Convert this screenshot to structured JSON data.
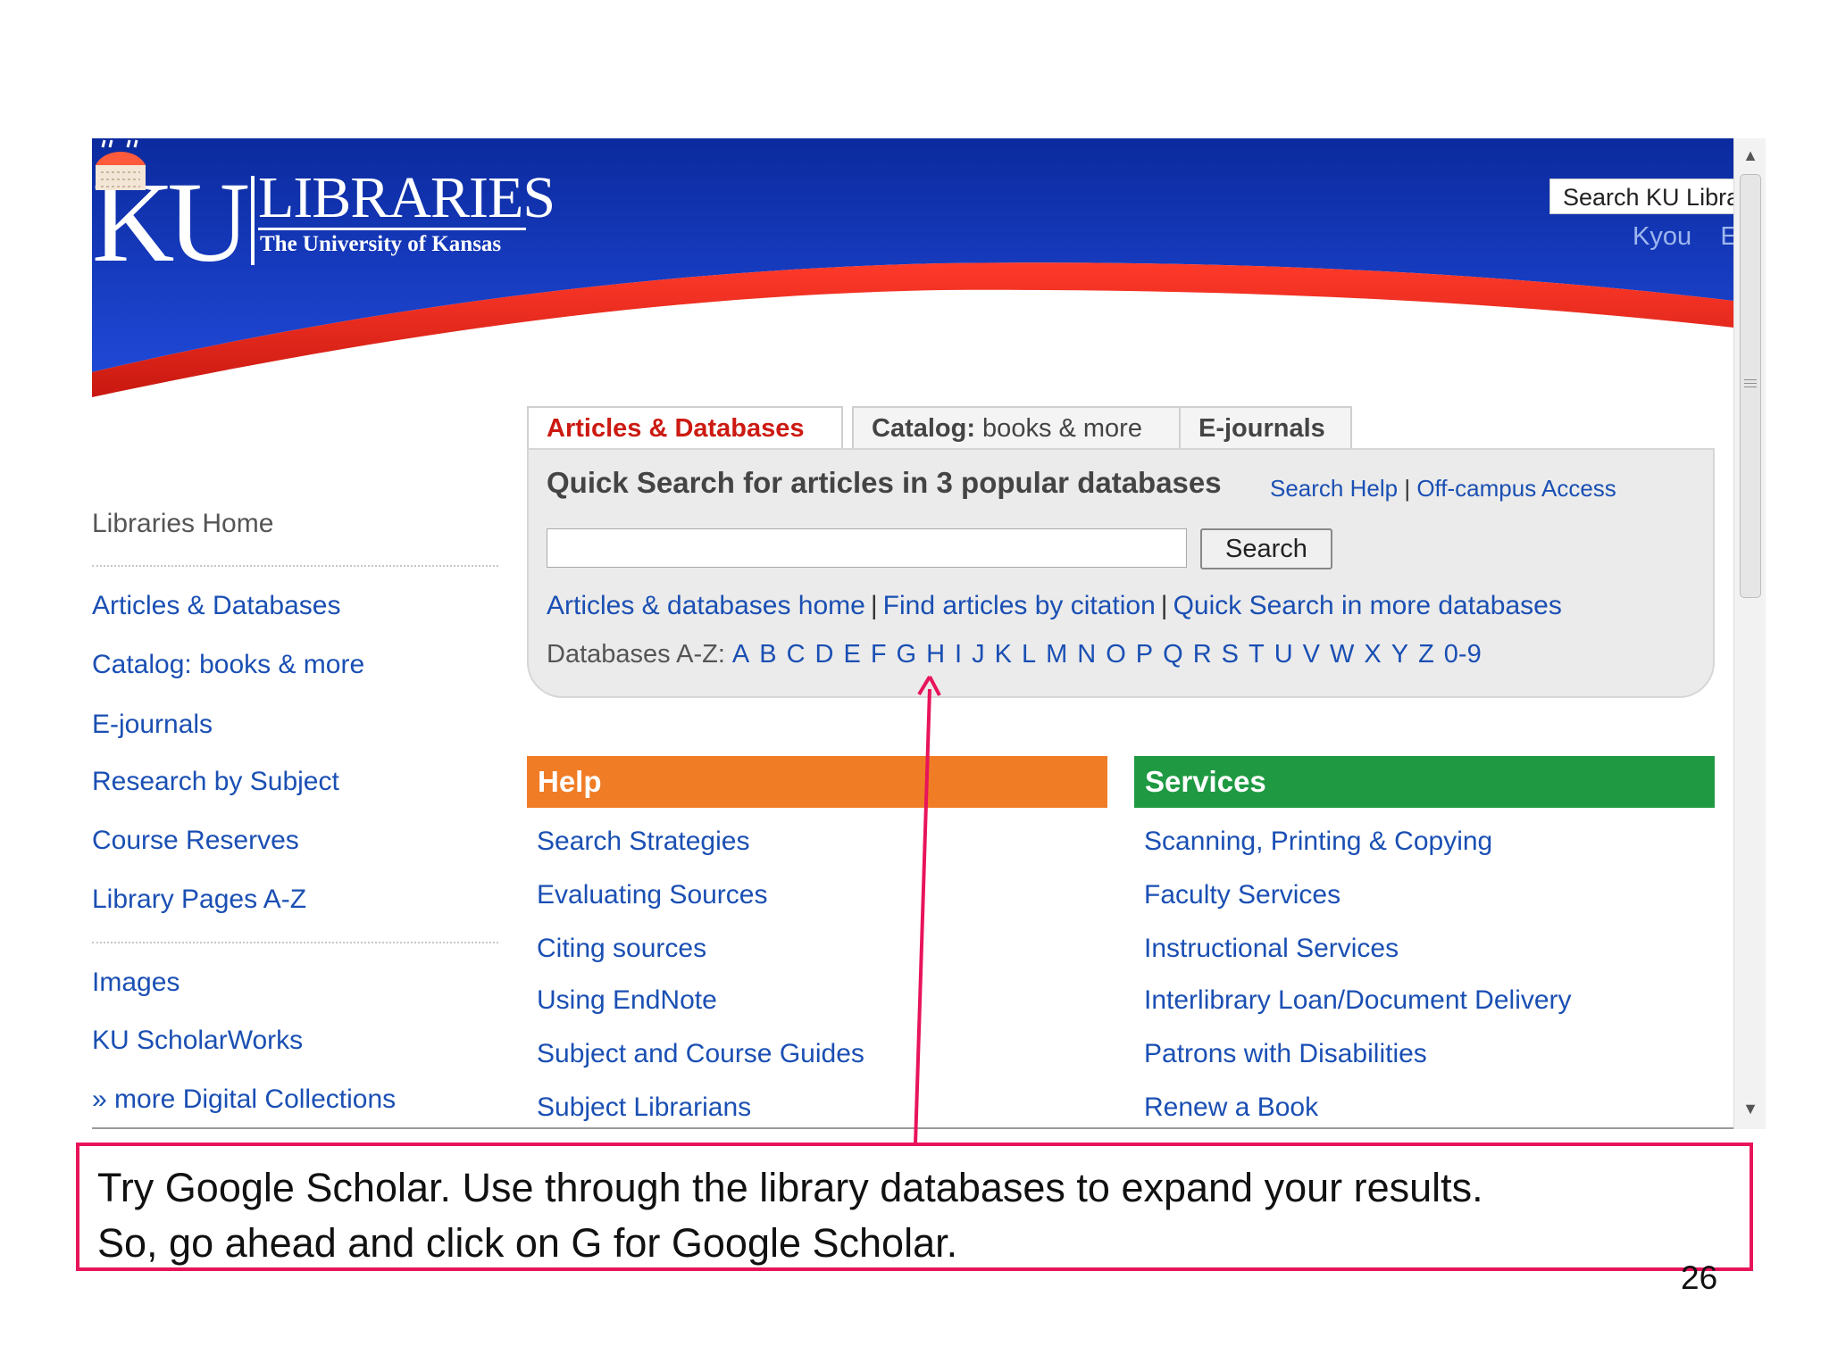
{
  "header": {
    "logo_ku": "KU",
    "logo_libraries": "LIBRARIES",
    "logo_university": "The University of Kansas",
    "search_placeholder": "Search KU Libra",
    "kyou_link": "Kyou    E"
  },
  "sidebar": {
    "home": "Libraries Home",
    "group1": [
      "Articles & Databases",
      "Catalog: books & more",
      "E-journals",
      "Research by Subject",
      "Course Reserves",
      "Library Pages A-Z"
    ],
    "group2": [
      "Images",
      "KU ScholarWorks",
      "» more Digital Collections"
    ]
  },
  "tabs": {
    "articles": "Articles & Databases",
    "catalog_bold": "Catalog:",
    "catalog_rest": " books & more",
    "ejournals": "E-journals"
  },
  "quick_search": {
    "title": "Quick Search for articles in 3 popular databases",
    "help_link": "Search Help",
    "offcampus_link": "Off-campus Access",
    "sep": "|",
    "button": "Search",
    "links": [
      "Articles & databases home",
      "Find articles by citation",
      "Quick Search in more databases"
    ],
    "az_label": "Databases A-Z:",
    "az_letters": [
      "A",
      "B",
      "C",
      "D",
      "E",
      "F",
      "G",
      "H",
      "I",
      "J",
      "K",
      "L",
      "M",
      "N",
      "O",
      "P",
      "Q",
      "R",
      "S",
      "T",
      "U",
      "V",
      "W",
      "X",
      "Y",
      "Z",
      "0-9"
    ]
  },
  "help": {
    "title": "Help",
    "links": [
      "Search Strategies",
      "Evaluating Sources",
      "Citing sources",
      "Using EndNote",
      "Subject and Course Guides",
      "Subject Librarians"
    ]
  },
  "services": {
    "title": "Services",
    "links": [
      "Scanning, Printing & Copying",
      "Faculty Services",
      "Instructional Services",
      "Interlibrary Loan/Document Delivery",
      "Patrons with Disabilities",
      "Renew a Book"
    ]
  },
  "caption": {
    "line1": "Try Google Scholar. Use through the library databases to expand your results.",
    "line2": "So, go ahead and click on G for Google Scholar."
  },
  "page_number": "26",
  "colors": {
    "header_blue": "#1233b8",
    "header_red": "#e2231a",
    "help_orange": "#f07c26",
    "services_green": "#1f9a43",
    "annotation_pink": "#e8145a",
    "link_blue": "#1a4fb3"
  }
}
